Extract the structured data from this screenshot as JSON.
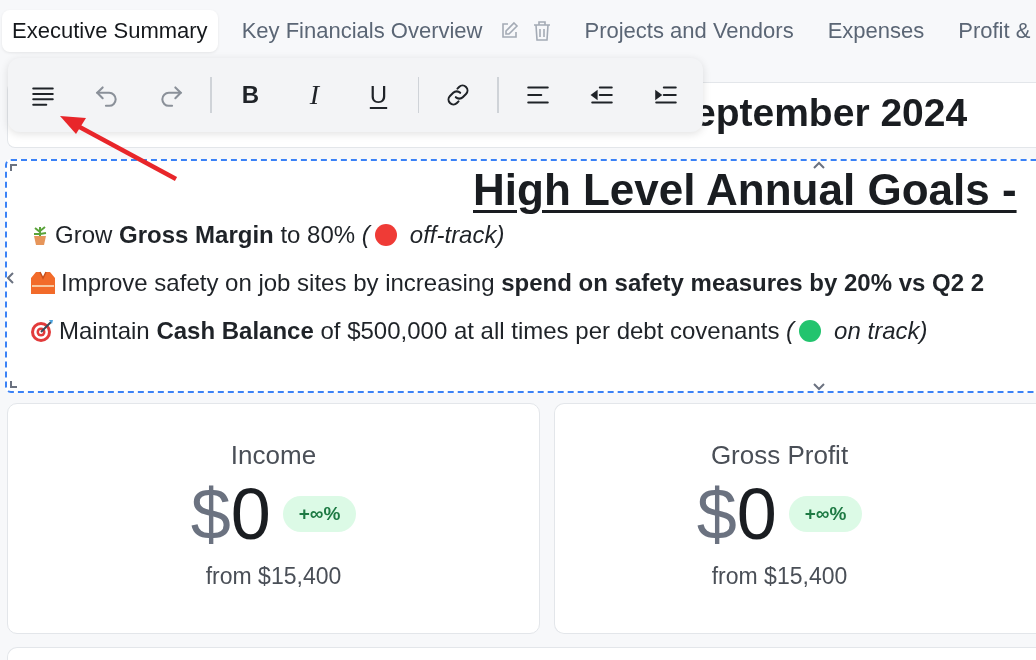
{
  "tabs": [
    {
      "label": "Executive Summary",
      "selected": true,
      "editable": false
    },
    {
      "label": "Key Financials Overview",
      "selected": false,
      "editable": true
    },
    {
      "label": "Projects and Vendors",
      "selected": false,
      "editable": false
    },
    {
      "label": "Expenses",
      "selected": false,
      "editable": false
    },
    {
      "label": "Profit &",
      "selected": false,
      "editable": false
    }
  ],
  "toolbar": [
    {
      "kind": "menu"
    },
    {
      "kind": "undo"
    },
    {
      "kind": "redo"
    },
    {
      "kind": "separator"
    },
    {
      "kind": "bold",
      "label": "B"
    },
    {
      "kind": "italic",
      "label": "I"
    },
    {
      "kind": "underline",
      "label": "U"
    },
    {
      "kind": "separator"
    },
    {
      "kind": "link"
    },
    {
      "kind": "separator"
    },
    {
      "kind": "align"
    },
    {
      "kind": "outdent"
    },
    {
      "kind": "indent"
    }
  ],
  "title": "eptember 2024",
  "goals": {
    "heading": "High Level Annual Goals -",
    "items": [
      {
        "text": "Grow **Gross Margin** to 80% *(*",
        "status": {
          "color": "#ef3b36",
          "label": "off-track)"
        }
      },
      {
        "text": "Improve safety on job sites by increasing **spend on safety measures by 20% vs Q2 2**"
      },
      {
        "text": "Maintain **Cash Balance** of $500,000 at all times per debt covenants *(*",
        "status": {
          "color": "#22c46e",
          "label": "on track)"
        }
      }
    ]
  },
  "cards": [
    {
      "title": "Income",
      "currency": "$",
      "value": "0",
      "change": "+∞%",
      "baseline": "from $15,400"
    },
    {
      "title": "Gross Profit",
      "currency": "$",
      "value": "0",
      "change": "+∞%",
      "baseline": "from $15,400"
    }
  ]
}
